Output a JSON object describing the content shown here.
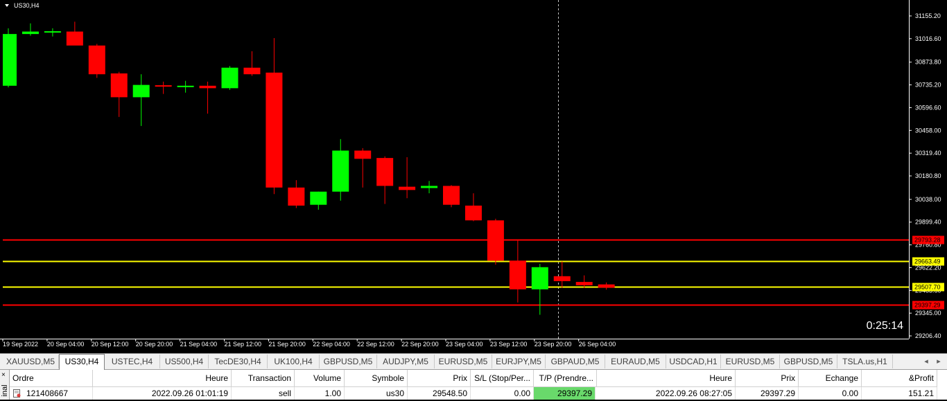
{
  "chart_data": {
    "type": "candlestick",
    "title": "US30,H4",
    "timer": "0:25:14",
    "y_ticks": [
      "31155.20",
      "31016.60",
      "30873.80",
      "30735.20",
      "30596.60",
      "30458.00",
      "30319.40",
      "30180.80",
      "30038.00",
      "29899.40",
      "29760.80",
      "29622.20",
      "29483.60",
      "29345.00",
      "29206.40"
    ],
    "x_ticks": [
      "19 Sep 2022",
      "20 Sep 04:00",
      "20 Sep 12:00",
      "20 Sep 20:00",
      "21 Sep 04:00",
      "21 Sep 12:00",
      "21 Sep 20:00",
      "22 Sep 04:00",
      "22 Sep 12:00",
      "22 Sep 20:00",
      "23 Sep 04:00",
      "23 Sep 12:00",
      "23 Sep 20:00",
      "26 Sep 04:00"
    ],
    "ylim": [
      29206.4,
      31155.2
    ],
    "candles": [
      {
        "o": 30730,
        "h": 31080,
        "l": 30720,
        "c": 31045
      },
      {
        "o": 31045,
        "h": 31110,
        "l": 31035,
        "c": 31060
      },
      {
        "o": 31058,
        "h": 31080,
        "l": 31030,
        "c": 31062
      },
      {
        "o": 31060,
        "h": 31120,
        "l": 30990,
        "c": 30975
      },
      {
        "o": 30975,
        "h": 30985,
        "l": 30778,
        "c": 30800
      },
      {
        "o": 30805,
        "h": 30815,
        "l": 30540,
        "c": 30660
      },
      {
        "o": 30660,
        "h": 30800,
        "l": 30485,
        "c": 30735
      },
      {
        "o": 30733,
        "h": 30755,
        "l": 30680,
        "c": 30727
      },
      {
        "o": 30730,
        "h": 30760,
        "l": 30688,
        "c": 30730
      },
      {
        "o": 30730,
        "h": 30755,
        "l": 30560,
        "c": 30715
      },
      {
        "o": 30715,
        "h": 30850,
        "l": 30705,
        "c": 30840
      },
      {
        "o": 30840,
        "h": 30940,
        "l": 30790,
        "c": 30800
      },
      {
        "o": 30810,
        "h": 31020,
        "l": 30070,
        "c": 30110
      },
      {
        "o": 30110,
        "h": 30155,
        "l": 29985,
        "c": 30000
      },
      {
        "o": 30005,
        "h": 30085,
        "l": 29975,
        "c": 30085
      },
      {
        "o": 30085,
        "h": 30405,
        "l": 30030,
        "c": 30335
      },
      {
        "o": 30335,
        "h": 30350,
        "l": 30110,
        "c": 30285
      },
      {
        "o": 30290,
        "h": 30300,
        "l": 30010,
        "c": 30120
      },
      {
        "o": 30115,
        "h": 30295,
        "l": 30045,
        "c": 30095
      },
      {
        "o": 30107,
        "h": 30150,
        "l": 30075,
        "c": 30120
      },
      {
        "o": 30120,
        "h": 30125,
        "l": 29990,
        "c": 30005
      },
      {
        "o": 30000,
        "h": 30075,
        "l": 29905,
        "c": 29910
      },
      {
        "o": 29910,
        "h": 29920,
        "l": 29640,
        "c": 29665
      },
      {
        "o": 29665,
        "h": 29795,
        "l": 29410,
        "c": 29490
      },
      {
        "o": 29490,
        "h": 29645,
        "l": 29335,
        "c": 29625
      },
      {
        "o": 29570,
        "h": 29660,
        "l": 29500,
        "c": 29540
      },
      {
        "o": 29535,
        "h": 29575,
        "l": 29500,
        "c": 29515
      },
      {
        "o": 29520,
        "h": 29532,
        "l": 29488,
        "c": 29500
      }
    ],
    "levels": [
      {
        "price": 29793.28,
        "label": "29793.28",
        "color": "#ff0000",
        "label_bg": "#ff0000",
        "label_color": "#000000"
      },
      {
        "price": 29663.49,
        "label": "29663.49",
        "color": "#ffff00",
        "label_bg": "#ffff00",
        "label_color": "#000000"
      },
      {
        "price": 29507.7,
        "label": "29507.70",
        "color": "#ffff00",
        "label_bg": "#ffff00",
        "label_color": "#000000"
      },
      {
        "price": 29397.29,
        "label": "29397.29",
        "color": "#ff0000",
        "label_bg": "#ff0000",
        "label_color": "#000000"
      }
    ],
    "bull_color": "#00ff00",
    "bear_color": "#ff0000",
    "grid": false
  },
  "tabs": [
    "XAUUSD,M5",
    "US30,H4",
    "USTEC,H4",
    "US500,H4",
    "TecDE30,H4",
    "UK100,H4",
    "GBPUSD,M5",
    "AUDJPY,M5",
    "EURUSD,M5",
    "EURJPY,M5",
    "GBPAUD,M5",
    "EURAUD,M5",
    "USDCAD,H1",
    "EURUSD,M5",
    "GBPUSD,M5",
    "TSLA.us,H1"
  ],
  "active_tab": "US30,H4",
  "tab_arrow_left": "◂",
  "tab_arrow_right": "▸",
  "terminal": {
    "side_label": "inal",
    "close": "×",
    "headers": {
      "ordre": "Ordre",
      "heure": "Heure",
      "transaction": "Transaction",
      "volume": "Volume",
      "symbole": "Symbole",
      "prix": "Prix",
      "sl": "S/L (Stop/Per...",
      "tp": "T/P (Prendre...",
      "heure2": "Heure",
      "prix2": "Prix",
      "echange": "Echange",
      "profit": "&Profit"
    },
    "row": {
      "ordre": "121408667",
      "heure": "2022.09.26 01:01:19",
      "transaction": "sell",
      "volume": "1.00",
      "symbole": "us30",
      "prix": "29548.50",
      "sl": "0.00",
      "tp": "29397.29",
      "heure2": "2022.09.26 08:27:05",
      "prix2": "29397.29",
      "echange": "0.00",
      "profit": "151.21"
    }
  }
}
